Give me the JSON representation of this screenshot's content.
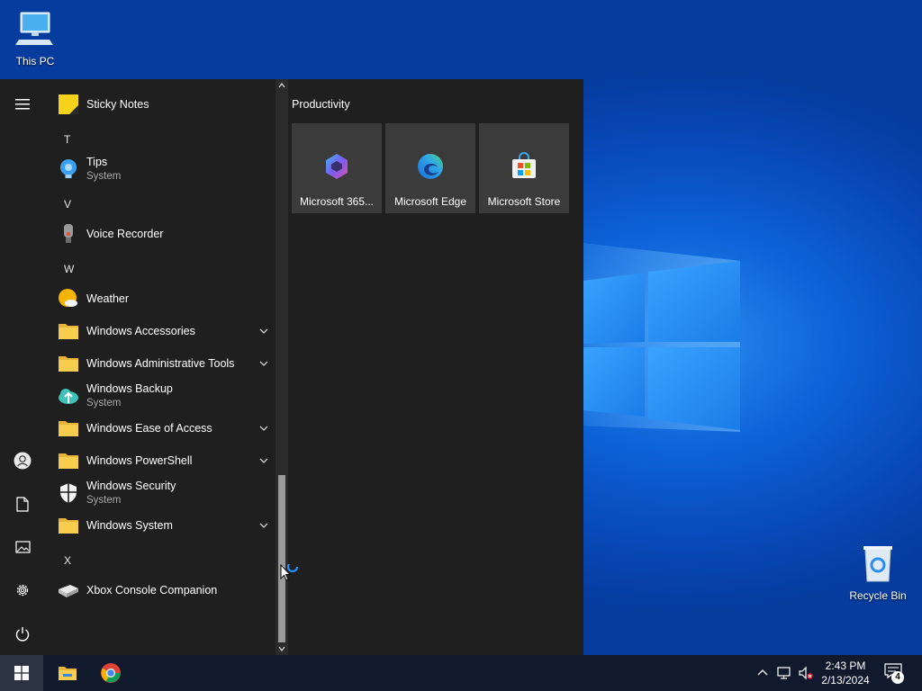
{
  "desktop": {
    "icons": [
      {
        "label": "This PC"
      },
      {
        "label": "Recycle Bin"
      }
    ]
  },
  "start_menu": {
    "apps": [
      {
        "kind": "app",
        "name": "Sticky Notes",
        "icon": "sticky-notes-icon"
      },
      {
        "kind": "letter",
        "name": "T"
      },
      {
        "kind": "app",
        "name": "Tips",
        "sub": "System",
        "icon": "tips-icon"
      },
      {
        "kind": "letter",
        "name": "V"
      },
      {
        "kind": "app",
        "name": "Voice Recorder",
        "icon": "microphone-icon"
      },
      {
        "kind": "letter",
        "name": "W"
      },
      {
        "kind": "app",
        "name": "Weather",
        "icon": "weather-icon"
      },
      {
        "kind": "folder",
        "name": "Windows Accessories",
        "icon": "folder-icon"
      },
      {
        "kind": "folder",
        "name": "Windows Administrative Tools",
        "icon": "folder-icon"
      },
      {
        "kind": "app",
        "name": "Windows Backup",
        "sub": "System",
        "icon": "backup-cloud-icon"
      },
      {
        "kind": "folder",
        "name": "Windows Ease of Access",
        "icon": "folder-icon"
      },
      {
        "kind": "folder",
        "name": "Windows PowerShell",
        "icon": "folder-icon"
      },
      {
        "kind": "app",
        "name": "Windows Security",
        "sub": "System",
        "icon": "shield-icon"
      },
      {
        "kind": "folder",
        "name": "Windows System",
        "icon": "folder-icon"
      },
      {
        "kind": "letter",
        "name": "X"
      },
      {
        "kind": "app",
        "name": "Xbox Console Companion",
        "icon": "xbox-console-icon"
      }
    ],
    "group_title": "Productivity",
    "tiles": [
      {
        "label": "Microsoft 365...",
        "icon": "microsoft-365-icon"
      },
      {
        "label": "Microsoft Edge",
        "icon": "edge-icon"
      },
      {
        "label": "Microsoft Store",
        "icon": "store-icon"
      }
    ]
  },
  "taskbar": {
    "time": "2:43 PM",
    "date": "2/13/2024",
    "notification_count": "4"
  },
  "colors": {
    "start_bg": "#1f1f1f",
    "tile_bg": "#3b3b3b",
    "taskbar_bg": "#101a2c",
    "accent": "#0d63d8"
  }
}
